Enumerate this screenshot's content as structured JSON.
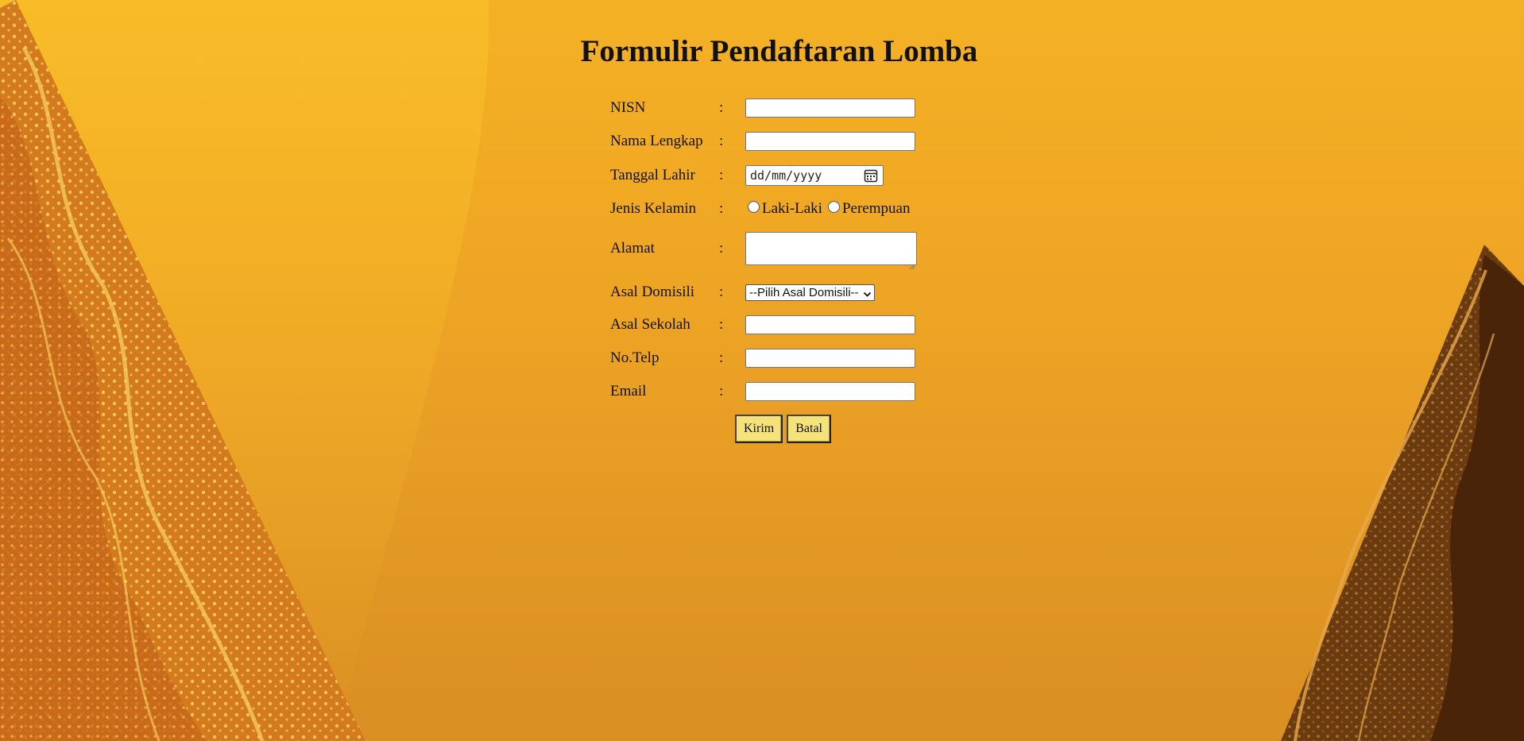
{
  "page": {
    "title": "Formulir Pendaftaran Lomba"
  },
  "form": {
    "nisn": {
      "label": "NISN",
      "sep": ":",
      "value": ""
    },
    "nama": {
      "label": "Nama Lengkap",
      "sep": ":",
      "value": ""
    },
    "tanggal": {
      "label": "Tanggal Lahir",
      "sep": ":",
      "placeholder": "dd/mm/yyyy"
    },
    "gender": {
      "label": "Jenis Kelamin",
      "sep": ":",
      "options": [
        "Laki-Laki",
        "Perempuan"
      ]
    },
    "alamat": {
      "label": "Alamat",
      "sep": ":",
      "value": ""
    },
    "domisili": {
      "label": "Asal Domisili",
      "sep": ":",
      "selected": "--Pilih Asal Domisili--"
    },
    "sekolah": {
      "label": "Asal Sekolah",
      "sep": ":",
      "value": ""
    },
    "telp": {
      "label": "No.Telp",
      "sep": ":",
      "value": ""
    },
    "email": {
      "label": "Email",
      "sep": ":",
      "value": ""
    },
    "buttons": {
      "submit": "Kirim",
      "cancel": "Batal"
    }
  },
  "colors": {
    "background": "#f0a624",
    "button": "#f6e27a",
    "wayang_light": "#f6c95a",
    "wayang_dark": "#4a2408"
  },
  "icons": {
    "date": "calendar-icon",
    "select": "chevron-down-icon"
  }
}
